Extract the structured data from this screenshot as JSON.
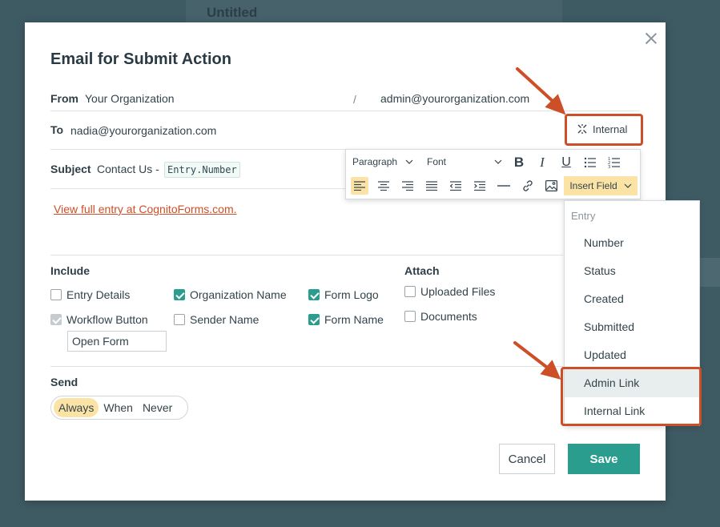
{
  "background": {
    "form_title": "Untitled"
  },
  "dialog": {
    "title": "Email for Submit Action",
    "from": {
      "label": "From",
      "name": "Your Organization",
      "separator": "/",
      "email": "admin@yourorganization.com"
    },
    "to": {
      "label": "To",
      "value": "nadia@yourorganization.com",
      "internal_label": "Internal"
    },
    "subject": {
      "label": "Subject",
      "text": "Contact Us -",
      "token": "Entry.Number"
    },
    "body_link": "View full entry at CognitoForms.com.",
    "include": {
      "label": "Include",
      "options": [
        {
          "label": "Entry Details",
          "checked": false
        },
        {
          "label": "Organization Name",
          "checked": true
        },
        {
          "label": "Form Logo",
          "checked": true
        },
        {
          "label": "Workflow Button",
          "checked": true,
          "disabled": true
        },
        {
          "label": "Sender Name",
          "checked": false
        },
        {
          "label": "Form Name",
          "checked": true
        }
      ],
      "workflow_button_text": "Open Form"
    },
    "attach": {
      "label": "Attach",
      "options": [
        {
          "label": "Uploaded Files",
          "checked": false
        },
        {
          "label": "Documents",
          "checked": false
        }
      ]
    },
    "send": {
      "label": "Send",
      "options": [
        "Always",
        "When",
        "Never"
      ],
      "selected": "Always"
    },
    "buttons": {
      "cancel": "Cancel",
      "save": "Save"
    }
  },
  "toolbar": {
    "paragraph": "Paragraph",
    "font": "Font",
    "bold": "B",
    "italic": "I",
    "underline": "U",
    "insert_field": "Insert Field"
  },
  "insert_dropdown": {
    "header": "Entry",
    "items": [
      "Number",
      "Status",
      "Created",
      "Submitted",
      "Updated",
      "Admin Link",
      "Internal Link"
    ],
    "hovered": "Admin Link"
  },
  "colors": {
    "accent": "#2a9d8f",
    "highlight": "#cd4f27",
    "active": "#fbe3a5"
  }
}
